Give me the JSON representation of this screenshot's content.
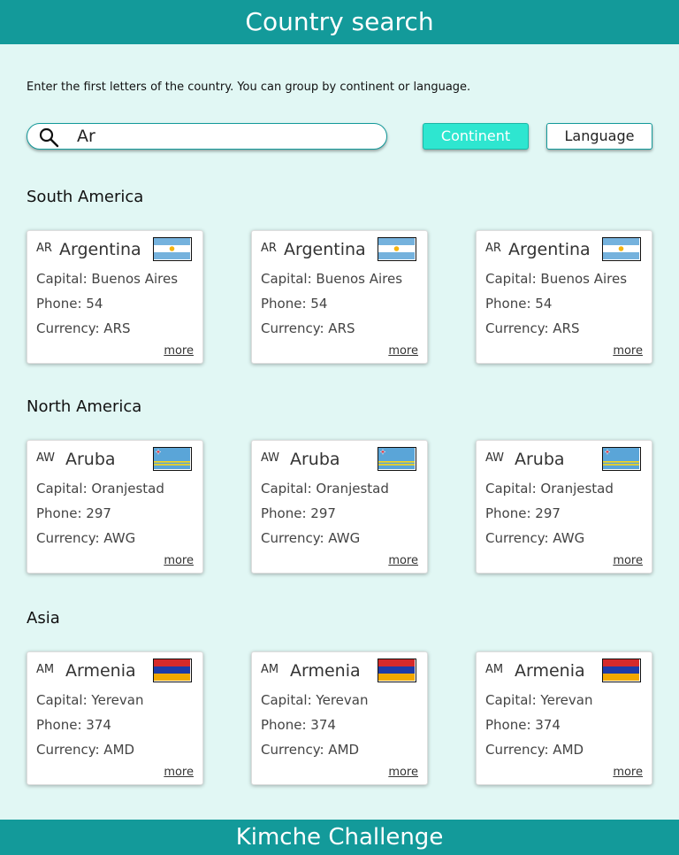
{
  "header": {
    "title": "Country search"
  },
  "instructions": "Enter the first letters of the country. You can group by continent or language.",
  "search": {
    "value": "Ar",
    "icon": "search-icon"
  },
  "buttons": {
    "continent": "Continent",
    "language": "Language",
    "active": "continent"
  },
  "labels": {
    "capital": "Capital: ",
    "phone": "Phone: ",
    "currency": "Currency: ",
    "more": "more"
  },
  "groups": [
    {
      "title": "South America",
      "country": {
        "code": "AR",
        "name": "Argentina",
        "capital": "Buenos Aires",
        "phone": "54",
        "currency": "ARS",
        "flag": "argentina"
      },
      "count": 3
    },
    {
      "title": "North America",
      "country": {
        "code": "AW",
        "name": "Aruba",
        "capital": "Oranjestad",
        "phone": "297",
        "currency": "AWG",
        "flag": "aruba"
      },
      "count": 3
    },
    {
      "title": "Asia",
      "country": {
        "code": "AM",
        "name": "Armenia",
        "capital": "Yerevan",
        "phone": "374",
        "currency": "AMD",
        "flag": "armenia"
      },
      "count": 3
    }
  ],
  "colors": {
    "accent": "#139a9a",
    "button_active": "#2ee6d0",
    "background": "#e1f7f4"
  },
  "footer": {
    "text": "Kimche Challenge"
  }
}
